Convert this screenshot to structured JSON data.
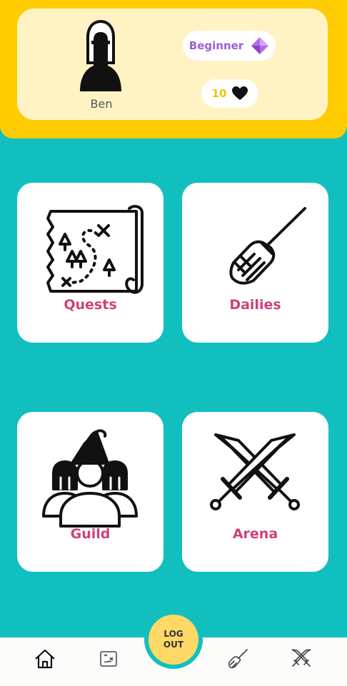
{
  "profile": {
    "name": "Ben",
    "rank": "Beginner",
    "lives": "10"
  },
  "tiles": [
    {
      "label": "Quests",
      "icon": "treasure-map-icon"
    },
    {
      "label": "Dailies",
      "icon": "broom-icon"
    },
    {
      "label": "Guild",
      "icon": "guild-group-icon"
    },
    {
      "label": "Arena",
      "icon": "crossed-swords-icon"
    }
  ],
  "nav": {
    "logout_line1": "LOG",
    "logout_line2": "OUT",
    "items": [
      "home-icon",
      "treasure-map-icon",
      "broom-icon",
      "crossed-swords-icon"
    ]
  },
  "colors": {
    "header": "#FFCC00",
    "background": "#12BFBF",
    "tile_label": "#D23F7A",
    "rank_text": "#9B5FD6",
    "lives_text": "#F0C400",
    "logout_button": "#FFD966"
  }
}
